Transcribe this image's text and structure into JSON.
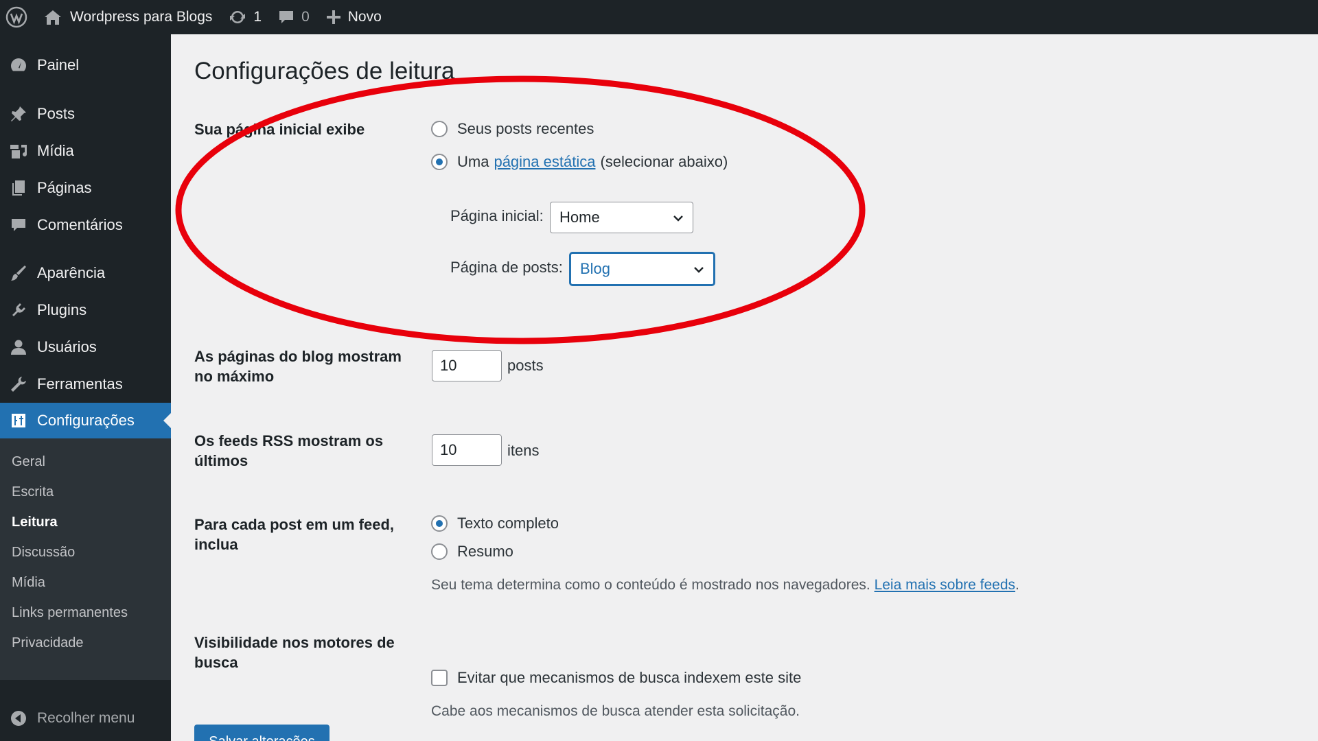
{
  "admin_bar": {
    "site_name": "Wordpress para Blogs",
    "updates_count": "1",
    "comments_count": "0",
    "new_label": "Novo"
  },
  "sidebar": {
    "items": [
      {
        "label": "Painel",
        "icon": "dashboard-icon"
      },
      {
        "label": "Posts",
        "icon": "pin-icon"
      },
      {
        "label": "Mídia",
        "icon": "media-icon"
      },
      {
        "label": "Páginas",
        "icon": "pages-icon"
      },
      {
        "label": "Comentários",
        "icon": "comment-icon"
      },
      {
        "label": "Aparência",
        "icon": "brush-icon"
      },
      {
        "label": "Plugins",
        "icon": "plugin-icon"
      },
      {
        "label": "Usuários",
        "icon": "user-icon"
      },
      {
        "label": "Ferramentas",
        "icon": "wrench-icon"
      },
      {
        "label": "Configurações",
        "icon": "settings-icon"
      }
    ],
    "submenu": [
      "Geral",
      "Escrita",
      "Leitura",
      "Discussão",
      "Mídia",
      "Links permanentes",
      "Privacidade"
    ],
    "collapse_label": "Recolher menu"
  },
  "page": {
    "title": "Configurações de leitura",
    "homepage": {
      "label": "Sua página inicial exibe",
      "option_recent": "Seus posts recentes",
      "option_static_prefix": "Uma",
      "option_static_link": "página estática",
      "option_static_suffix": "(selecionar abaixo)",
      "front_page_label": "Página inicial:",
      "front_page_value": "Home",
      "posts_page_label": "Página de posts:",
      "posts_page_value": "Blog"
    },
    "blog_pages": {
      "label": "As páginas do blog mostram no máximo",
      "value": "10",
      "unit": "posts"
    },
    "rss": {
      "label": "Os feeds RSS mostram os últimos",
      "value": "10",
      "unit": "itens"
    },
    "feed_content": {
      "label": "Para cada post em um feed, inclua",
      "option_full": "Texto completo",
      "option_summary": "Resumo",
      "desc_text": "Seu tema determina como o conteúdo é mostrado nos navegadores.",
      "desc_link": "Leia mais sobre feeds",
      "desc_end": "."
    },
    "visibility": {
      "label": "Visibilidade nos motores de busca",
      "checkbox_label": "Evitar que mecanismos de busca indexem este site",
      "desc": "Cabe aos mecanismos de busca atender esta solicitação."
    },
    "save_button": "Salvar alterações"
  },
  "colors": {
    "accent": "#2271b1",
    "sidebar_bg": "#1d2327",
    "annotation": "#e8000b"
  }
}
